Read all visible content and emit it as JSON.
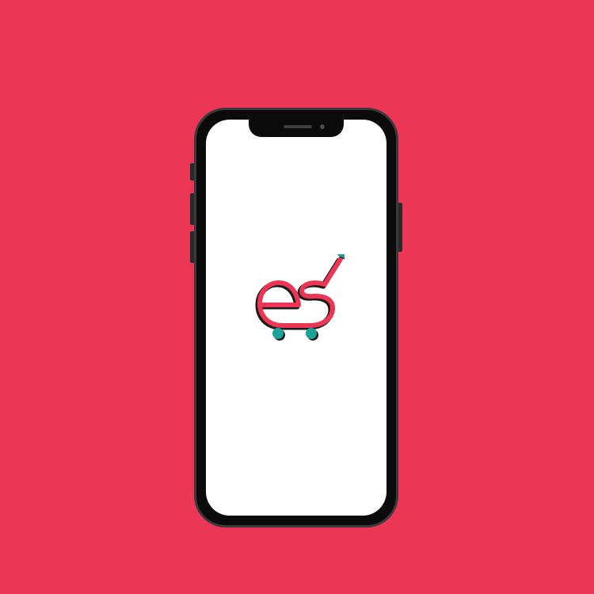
{
  "app": {
    "background_color": "#ec3655",
    "device": "phone",
    "screen": "splash"
  },
  "logo": {
    "icon": "shopping-cart-es-logo-icon",
    "colors": {
      "primary": "#ec3655",
      "shadow": "#1a1a1a",
      "accent": "#1aa39a"
    }
  }
}
